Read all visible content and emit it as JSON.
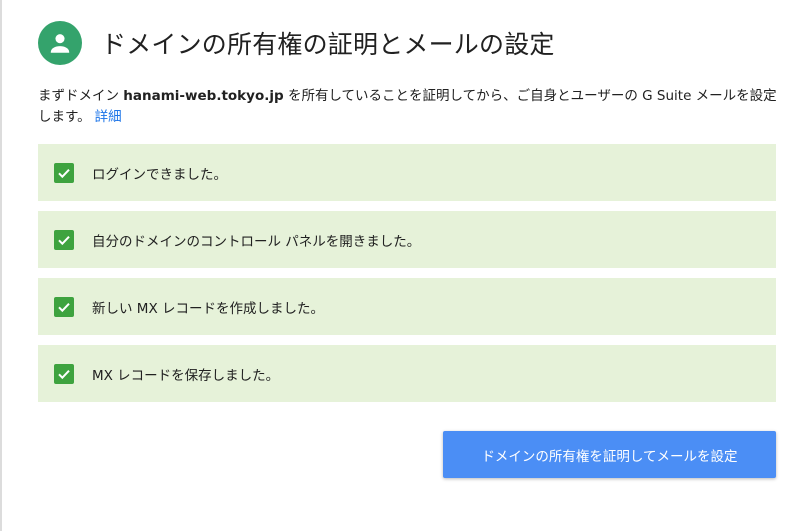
{
  "header": {
    "title": "ドメインの所有権の証明とメールの設定",
    "avatar_icon": "person-icon",
    "avatar_color": "#34a36c"
  },
  "description": {
    "prefix": "まずドメイン ",
    "domain": "hanami-web.tokyo.jp",
    "suffix": " を所有していることを証明してから、ご自身とユーザーの G Suite メールを設定します。",
    "learn_more": "詳細"
  },
  "steps": [
    {
      "label": "ログインできました。",
      "checked": true
    },
    {
      "label": "自分のドメインのコントロール パネルを開きました。",
      "checked": true
    },
    {
      "label": "新しい MX レコードを作成しました。",
      "checked": true
    },
    {
      "label": "MX レコードを保存しました。",
      "checked": true
    }
  ],
  "colors": {
    "step_background": "#e6f2d9",
    "checkbox": "#3ea33f",
    "button": "#4b8ef5",
    "link": "#1a73e8"
  },
  "actions": {
    "verify_button": "ドメインの所有権を証明してメールを設定"
  }
}
